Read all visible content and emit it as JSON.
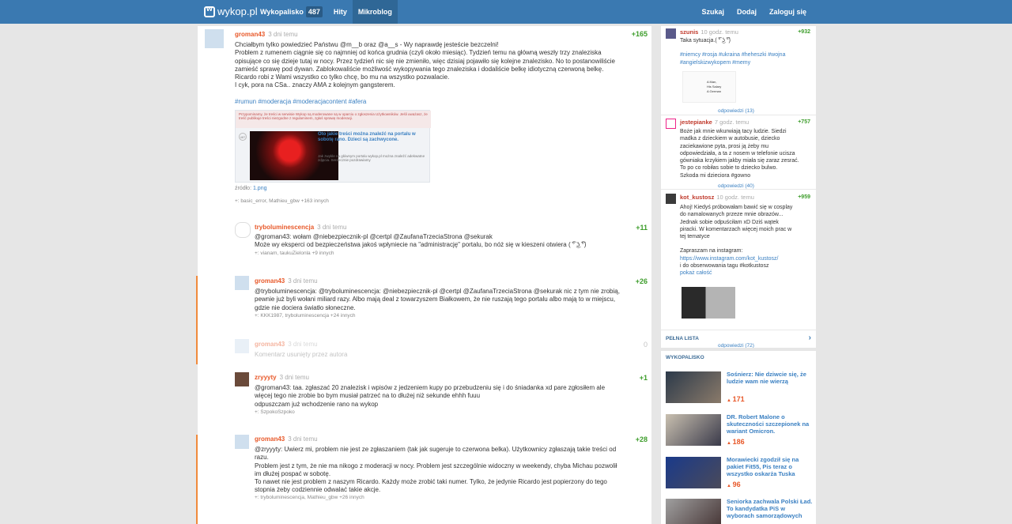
{
  "header": {
    "logo": "wykop.pl",
    "nav": [
      {
        "label": "Wykopalisko",
        "count": "487"
      },
      {
        "label": "Hity"
      },
      {
        "label": "Mikroblog"
      }
    ],
    "right": [
      "Szukaj",
      "Dodaj",
      "Zaloguj się"
    ]
  },
  "posts": [
    {
      "author": "groman43",
      "time": "3 dni temu",
      "score": "+165",
      "lines": [
        "Chciałbym tylko powiedzieć Państwu @m__b oraz @a__s - Wy naprawdę jesteście bezczelni!",
        "Problem z rumenem ciągnie się co najmniej od końca grudnia (czyli około miesiąc). Tydzień temu na główną weszły trzy znaleziska",
        "opisujące co się dzieje tutaj w nocy. Przez tydzień nic się nie zmieniło, więc dzisiaj pojawiło się kolejne znalezisko. No to postanowiliście",
        "zamieść sprawę pod dywan. Zablokowaliście możliwość wykopywania tego znaleziska i dodaliście belkę idiotyczną czerwoną belkę.",
        "Ricardo robi z Wami wszystko co tylko chcę, bo mu na wszystko pozwalacie.",
        "I cyk, pora na CSa.. znaczy AMA z kolejnym gangsterem."
      ],
      "tags": "#rumun #moderacja #moderacjacontent #afera",
      "embed": {
        "warning": "Przypominamy, że treści w serwisie Wykop są moderowane są w oparciu o zgłoszenia Użytkowników. Jeśli uważasz, że treść publikuje treści niezgodne z regulaminem, zgłoś sprawę moderacji.",
        "title": "Oto jakie treści można znaleźć na portalu w sobotę rano. Dzieci są zachwycone.",
        "desc": "Jak zwykle na głównym portalu wykop.pl można znaleźć adekwatne zdjęcia. Serdecznie pozdrawiamy",
        "badge": "487"
      },
      "source_label": "źródło:",
      "source": "1.png",
      "voters": "+: basic_error, Mathieu_gbw +163 innych"
    },
    {
      "author": "tryboluminescencja",
      "time": "3 dni temu",
      "score": "+11",
      "lines": [
        "@groman43: wołam @niebezpiecznik-pl @certpl @ZaufanaTrzeciaStrona @sekurak",
        "Może wy eksperci od bezpieczeństwa jakoś wpłyniecie na \"administrację\" portalu, bo nóż się w kieszeni otwiera ( ͡° ͜ʖ ͡°)"
      ],
      "voters": "+: vianam, taukuZielonla +9 innych"
    },
    {
      "author": "groman43",
      "time": "3 dni temu",
      "score": "+26",
      "lines": [
        "@tryboluminescencja: @tryboluminescencja: @niebezpiecznik-pl @certpl @ZaufanaTrzeciaStrona @sekurak nic z tym nie zrobią,",
        "pewnie już byli wołani miliard razy. Albo mają deal z towarzyszem Białkowem, że nie ruszają tego portalu albo mają to w miejscu,",
        "gdzie nie dociera światło słoneczne."
      ],
      "voters": "+: KKK1987, tryboluminescencja +24 innych"
    },
    {
      "author": "groman43",
      "time": "3 dni temu",
      "score": "0",
      "lines": [
        "Komentarz usunięty przez autora"
      ]
    },
    {
      "author": "zryyyty",
      "time": "3 dni temu",
      "score": "+1",
      "lines": [
        "@groman43: taa. zgłaszać 20 znalezisk i wpisów z jedzeniem kupy po przebudzeniu się i do śniadanka xd pare zgłosiłem ale",
        "więcej tego nie zrobie bo bym musiał patrzeć na to dłużej niż sekunde ehhh fuuu",
        "odpuszczam już wchodzenie rano na wykop"
      ],
      "voters": "+: SzpokoSzpoko"
    },
    {
      "author": "groman43",
      "time": "3 dni temu",
      "score": "+28",
      "lines": [
        "@zryyyty: Uwierz mi, problem nie jest ze zgłaszaniem (tak jak sugeruje to czerwona belka). Użytkownicy zgłaszają takie treści od",
        "razu.",
        "Problem jest z tym, że nie ma nikogo z moderacji w nocy. Problem jest szczególnie widoczny w weekendy, chyba Michau pozwolił",
        "im dłużej pospać w sobotę.",
        "To nawet nie jest problem z naszym Ricardo. Każdy może zrobić taki numer. Tylko, że jedynie Ricardo jest popierzony do tego",
        "stopnia żeby codziennie odwalać takie akcje."
      ],
      "voters": "+: tryboluminescencja, Mathieu_gbw +26 innych"
    }
  ],
  "sidebar": {
    "entries": [
      {
        "author": "szunis",
        "time": "10 godz. temu",
        "score": "+932",
        "lines": [
          "Taka sytuacja.( ͡° ͜ʖ ͡°)",
          "",
          "#niemcy #rosja #ukraina #heheszki #wojna",
          "#angielskizwykopem #memy"
        ],
        "meme": [
          "A Man,",
          "His Salary",
          "A German"
        ],
        "replies": "odpowiedzi (13)"
      },
      {
        "author": "jestepianke",
        "time": "7 godz. temu",
        "score": "+757",
        "lines": [
          "Boże jak mnie wkurwiają tacy ludzie. Siedzi",
          "madka z dzieckiem w autobusie, dziecko",
          "zaciekawione pyta, prosi ją żeby mu",
          "odpowiedziała, a ta z nosem w telefonie ucisza",
          "gówniaka krzykiem jakby miała się zaraz zesrać.",
          "To po co robiłas sobie to dziecko bulwo.",
          "Szkoda mi dzieciora #gowno"
        ],
        "replies": "odpowiedzi (40)"
      },
      {
        "author": "kot_kustosz",
        "time": "10 godz. temu",
        "score": "+959",
        "lines": [
          "Ahoj! Kiedyś próbowałam bawić się w cosplay",
          "do namalowanych przeze mnie obrazów...",
          "Jednak sobie odpuściłam xD Dziś wątek",
          "piracki. W komentarzach więcej moich prac w",
          "tej tematyce",
          "",
          "Zapraszam na instagram:",
          "https://www.instagram.com/kot_kustosz/",
          "i do obserwowania tagu #kotkustosz"
        ],
        "more": "pokaż całość",
        "replies": "odpowiedzi (72)"
      }
    ],
    "full_list": "PEŁNA LISTA",
    "section": "WYKOPALISKO",
    "links": [
      {
        "title": "Sośnierz: Nie dziwcie się, że ludzie wam nie wierzą",
        "digs": "171"
      },
      {
        "title": "DR. Robert Malone o skuteczności szczepionek na wariant Omicron.",
        "digs": "186"
      },
      {
        "title": "Morawiecki zgodził się na pakiet Fit55, Pis teraz o wszystko oskarża Tuska",
        "digs": "96"
      },
      {
        "title": "Seniorka zachwala Polski Ład. To kandydatka PiS w wyborach samorządowych",
        "digs": "..."
      }
    ]
  }
}
